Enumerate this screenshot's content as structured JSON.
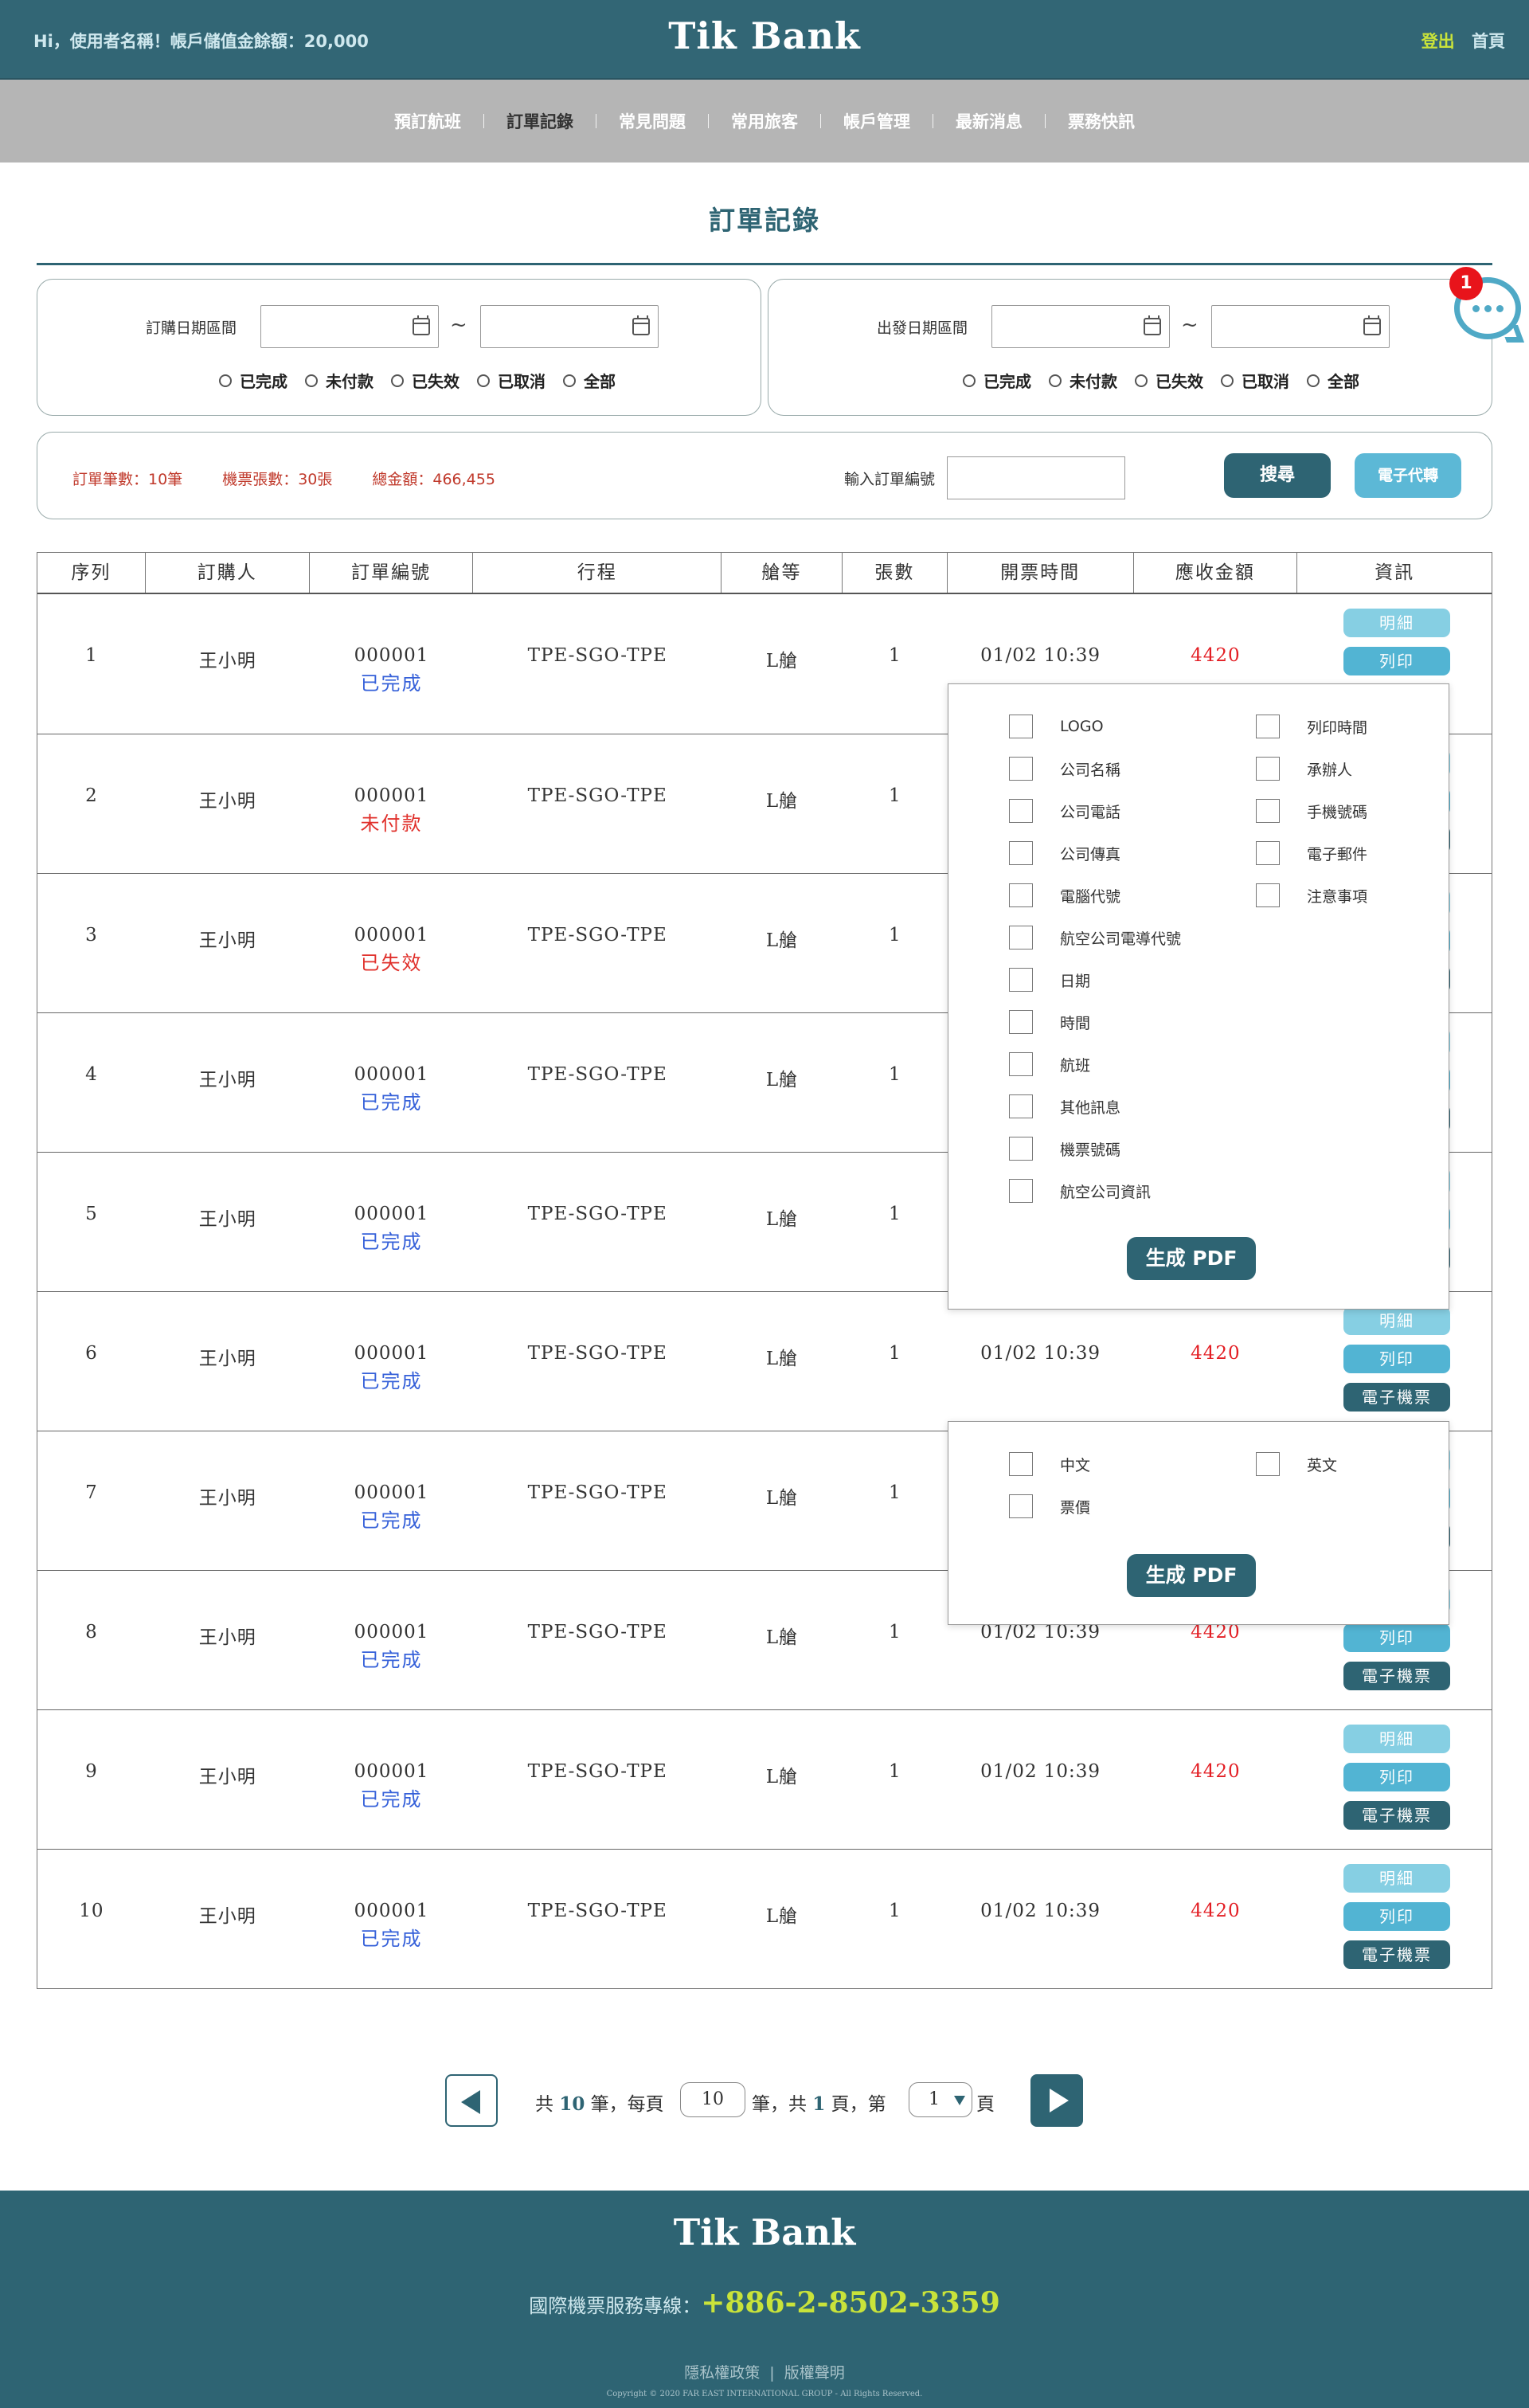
{
  "header": {
    "greeting": "Hi，使用者名稱！帳戶儲值金餘額：20,000",
    "logo": "Tik Bank",
    "logout": "登出",
    "home": "首頁"
  },
  "nav": [
    "預訂航班",
    "訂單記錄",
    "常見問題",
    "常用旅客",
    "帳戶管理",
    "最新消息",
    "票務快訊"
  ],
  "page_title": "訂單記錄",
  "filters": {
    "order_date_label": "訂購日期區間",
    "depart_date_label": "出發日期區間",
    "tilde": "~",
    "status_options": [
      "已完成",
      "未付款",
      "已失效",
      "已取消",
      "全部"
    ]
  },
  "chat": {
    "badge": "1"
  },
  "summary": {
    "orders": "訂單筆數：10筆",
    "tickets": "機票張數：30張",
    "total": "總金額：466,455",
    "order_no_label": "輸入訂單編號",
    "search_button": "搜尋",
    "echange_button": "電子代轉"
  },
  "table": {
    "headers": [
      "序列",
      "訂購人",
      "訂單編號",
      "行程",
      "艙等",
      "張數",
      "開票時間",
      "應收金額",
      "資訊"
    ],
    "rows": [
      {
        "no": "1",
        "name": "王小明",
        "order": "000001",
        "status": "已完成",
        "route": "TPE-SGO-TPE",
        "cabin": "L艙",
        "qty": "1",
        "time": "01/02 10:39",
        "amount": "4420"
      },
      {
        "no": "2",
        "name": "王小明",
        "order": "000001",
        "status": "未付款",
        "route": "TPE-SGO-TPE",
        "cabin": "L艙",
        "qty": "1",
        "time": "",
        "amount": ""
      },
      {
        "no": "3",
        "name": "王小明",
        "order": "000001",
        "status": "已失效",
        "route": "TPE-SGO-TPE",
        "cabin": "L艙",
        "qty": "1",
        "time": "",
        "amount": ""
      },
      {
        "no": "4",
        "name": "王小明",
        "order": "000001",
        "status": "已完成",
        "route": "TPE-SGO-TPE",
        "cabin": "L艙",
        "qty": "1",
        "time": "",
        "amount": ""
      },
      {
        "no": "5",
        "name": "王小明",
        "order": "000001",
        "status": "已完成",
        "route": "TPE-SGO-TPE",
        "cabin": "L艙",
        "qty": "1",
        "time": "",
        "amount": ""
      },
      {
        "no": "6",
        "name": "王小明",
        "order": "000001",
        "status": "已完成",
        "route": "TPE-SGO-TPE",
        "cabin": "L艙",
        "qty": "1",
        "time": "01/02 10:39",
        "amount": "4420"
      },
      {
        "no": "7",
        "name": "王小明",
        "order": "000001",
        "status": "已完成",
        "route": "TPE-SGO-TPE",
        "cabin": "L艙",
        "qty": "1",
        "time": "",
        "amount": ""
      },
      {
        "no": "8",
        "name": "王小明",
        "order": "000001",
        "status": "已完成",
        "route": "TPE-SGO-TPE",
        "cabin": "L艙",
        "qty": "1",
        "time": "01/02 10:39",
        "amount": "4420"
      },
      {
        "no": "9",
        "name": "王小明",
        "order": "000001",
        "status": "已完成",
        "route": "TPE-SGO-TPE",
        "cabin": "L艙",
        "qty": "1",
        "time": "01/02 10:39",
        "amount": "4420"
      },
      {
        "no": "10",
        "name": "王小明",
        "order": "000001",
        "status": "已完成",
        "route": "TPE-SGO-TPE",
        "cabin": "L艙",
        "qty": "1",
        "time": "01/02 10:39",
        "amount": "4420"
      }
    ],
    "op_detail": "明細",
    "op_print": "列印",
    "op_eticket": "電子機票"
  },
  "print_popup": {
    "left_items": [
      "LOGO",
      "公司名稱",
      "公司電話",
      "公司傳真",
      "電腦代號",
      "航空公司電導代號",
      "日期",
      "時間",
      "航班",
      "其他訊息",
      "機票號碼",
      "航空公司資訊"
    ],
    "right_items": [
      "列印時間",
      "承辦人",
      "手機號碼",
      "電子郵件",
      "注意事項"
    ],
    "button": "生成 PDF"
  },
  "eticket_popup": {
    "items": [
      "中文",
      "英文",
      "票價"
    ],
    "button": "生成 PDF"
  },
  "pager": {
    "t1": "共",
    "total": "10",
    "t2": "筆，每頁",
    "per_page": "10",
    "t3": "筆，共",
    "pages": "1",
    "t4": "頁，第",
    "current": "1",
    "t5": "頁"
  },
  "footer": {
    "logo": "Tik Bank",
    "hotline_label": "國際機票服務專線：",
    "hotline_number": "+886-2-8502-3359",
    "privacy": "隱私權政策",
    "sep": "|",
    "copyright_link": "版權聲明",
    "copyright": "Copyright © 2020 FAR EAST INTERNATIONAL GROUP - All Rights Reserved."
  },
  "colors": {
    "primary": "#2e6473",
    "accent": "#5cb8d6",
    "highlight": "#c9e33a",
    "danger": "#e31e24",
    "done": "#3560d9"
  }
}
